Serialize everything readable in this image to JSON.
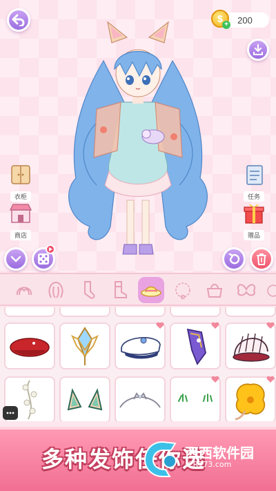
{
  "header": {
    "coins": "200",
    "coin_symbol": "$"
  },
  "side_menu": {
    "wardrobe": "衣柜",
    "shop": "商店",
    "tasks": "任务",
    "gifts": "赠品"
  },
  "tabs": [
    {
      "icon": "hair-front-icon"
    },
    {
      "icon": "hair-back-icon"
    },
    {
      "icon": "socks-icon"
    },
    {
      "icon": "boots-icon"
    },
    {
      "icon": "hat-icon",
      "active": true
    },
    {
      "icon": "necklace-icon"
    },
    {
      "icon": "bag-icon"
    },
    {
      "icon": "wings-icon"
    }
  ],
  "items": [
    {
      "icon": "red-beret-icon"
    },
    {
      "icon": "crystal-tiara-icon"
    },
    {
      "icon": "sailor-hat-icon"
    },
    {
      "icon": "purple-feather-clip-icon"
    },
    {
      "icon": "fan-headpiece-icon"
    },
    {
      "icon": "flower-vine-icon"
    },
    {
      "icon": "fox-ears-icon"
    },
    {
      "icon": "silver-tiara-icon"
    },
    {
      "icon": "eyelash-clips-icon"
    },
    {
      "icon": "yellow-flower-icon"
    }
  ],
  "banner": {
    "text": "多种发饰任你选"
  },
  "watermark": {
    "name": "西西软件园",
    "url": "CR173.com"
  },
  "colors": {
    "accent_purple": "#a77be6",
    "accent_pink": "#f16f92",
    "trash_red": "#f0546c",
    "coin_gold": "#f2b31c"
  }
}
